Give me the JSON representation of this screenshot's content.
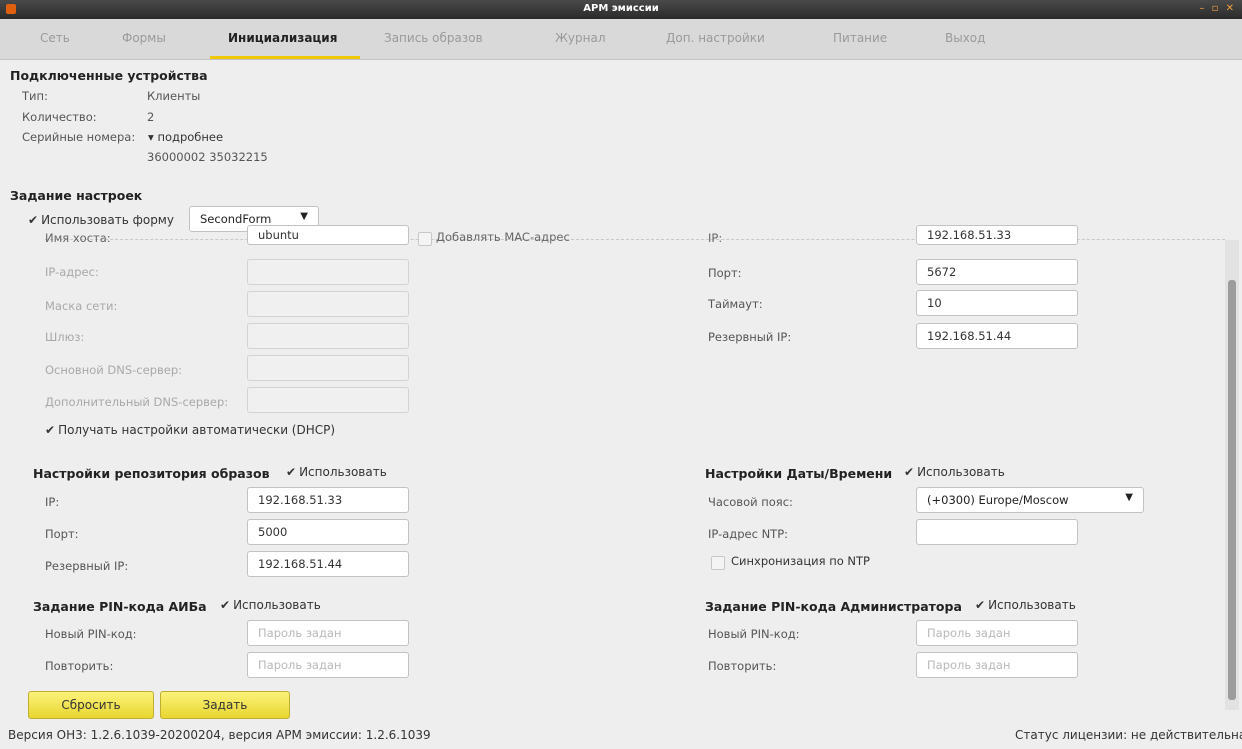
{
  "window": {
    "title": "АРМ эмиссии"
  },
  "tabs": [
    "Сеть",
    "Формы",
    "Инициализация",
    "Запись образов",
    "Журнал",
    "Доп. настройки",
    "Питание",
    "Выход"
  ],
  "devices": {
    "title": "Подключенные устройства",
    "type_label": "Тип:",
    "type_value": "Клиенты",
    "count_label": "Количество:",
    "count_value": "2",
    "serials_label": "Серийные номера:",
    "details_label": "подробнее",
    "serials_value": "36000002 35032215"
  },
  "settings": {
    "title": "Задание настроек",
    "use_form_label": "Использовать форму",
    "form_selected": "SecondForm"
  },
  "network": {
    "hostname_label": "Имя хоста:",
    "hostname_value": "ubuntu",
    "add_mac_label": "Добавлять MAC-адрес",
    "ip_label": "IP-адрес:",
    "mask_label": "Маска сети:",
    "gateway_label": "Шлюз:",
    "dns1_label": "Основной DNS-сервер:",
    "dns2_label": "Дополнительный DNS-сервер:",
    "dhcp_label": "Получать настройки автоматически (DHCP)"
  },
  "server": {
    "ip_label": "IP:",
    "ip_value": "192.168.51.33",
    "port_label": "Порт:",
    "port_value": "5672",
    "timeout_label": "Таймаут:",
    "timeout_value": "10",
    "backup_ip_label": "Резервный IP:",
    "backup_ip_value": "192.168.51.44"
  },
  "repo": {
    "title": "Настройки репозитория образов",
    "use_label": "Использовать",
    "ip_label": "IP:",
    "ip_value": "192.168.51.33",
    "port_label": "Порт:",
    "port_value": "5000",
    "backup_ip_label": "Резервный IP:",
    "backup_ip_value": "192.168.51.44"
  },
  "datetime": {
    "title": "Настройки Даты/Времени",
    "use_label": "Использовать",
    "tz_label": "Часовой пояс:",
    "tz_value": "(+0300) Europe/Moscow",
    "ntp_label": "IP-адрес NTP:",
    "ntp_sync_label": "Синхронизация по NTP"
  },
  "pin_aib": {
    "title": "Задание PIN-кода АИБа",
    "use_label": "Использовать",
    "new_label": "Новый PIN-код:",
    "repeat_label": "Повторить:",
    "placeholder": "Пароль задан"
  },
  "pin_admin": {
    "title": "Задание PIN-кода Администратора",
    "use_label": "Использовать",
    "new_label": "Новый PIN-код:",
    "repeat_label": "Повторить:",
    "placeholder": "Пароль задан"
  },
  "buttons": {
    "reset": "Сбросить",
    "apply": "Задать"
  },
  "status": {
    "version": "Версия ОН3: 1.2.6.1039-20200204, версия АРМ эмиссии: 1.2.6.1039",
    "license": "Статус лицензии: не действительна"
  },
  "colors": {
    "accent": "#f0c800",
    "button": "#f4e44c"
  }
}
